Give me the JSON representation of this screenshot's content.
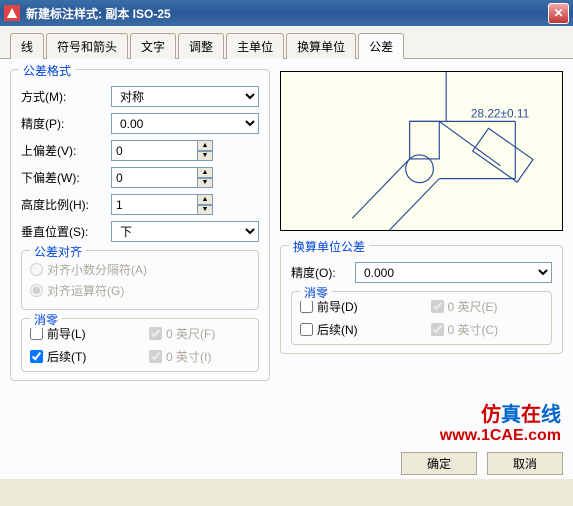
{
  "window": {
    "title": "新建标注样式: 副本 ISO-25"
  },
  "tabs": {
    "items": [
      "线",
      "符号和箭头",
      "文字",
      "调整",
      "主单位",
      "换算单位",
      "公差"
    ],
    "active": 6
  },
  "tolerance_format": {
    "legend": "公差格式",
    "method_label": "方式(M):",
    "method_value": "对称",
    "precision_label": "精度(P):",
    "precision_value": "0.00",
    "upper_label": "上偏差(V):",
    "upper_value": "0",
    "lower_label": "下偏差(W):",
    "lower_value": "0",
    "scale_label": "高度比例(H):",
    "scale_value": "1",
    "vpos_label": "垂直位置(S):",
    "vpos_value": "下"
  },
  "alignment": {
    "legend": "公差对齐",
    "decimal": "对齐小数分隔符(A)",
    "operator": "对齐运算符(G)"
  },
  "zero_left": {
    "legend": "消零",
    "leading": "前导(L)",
    "trailing": "后续(T)",
    "feet": "0 英尺(F)",
    "inches": "0 英寸(I)"
  },
  "altunit": {
    "legend": "换算单位公差",
    "precision_label": "精度(O):",
    "precision_value": "0.000"
  },
  "zero_right": {
    "legend": "消零",
    "leading": "前导(D)",
    "trailing": "后续(N)",
    "feet": "0 英尺(E)",
    "inches": "0 英寸(C)"
  },
  "buttons": {
    "ok": "确定",
    "cancel": "取消"
  },
  "watermark": {
    "l1a": "仿",
    "l1b": "真",
    "l1c": "在",
    "l1d": "线",
    "l2": "www.1CAE.com"
  }
}
